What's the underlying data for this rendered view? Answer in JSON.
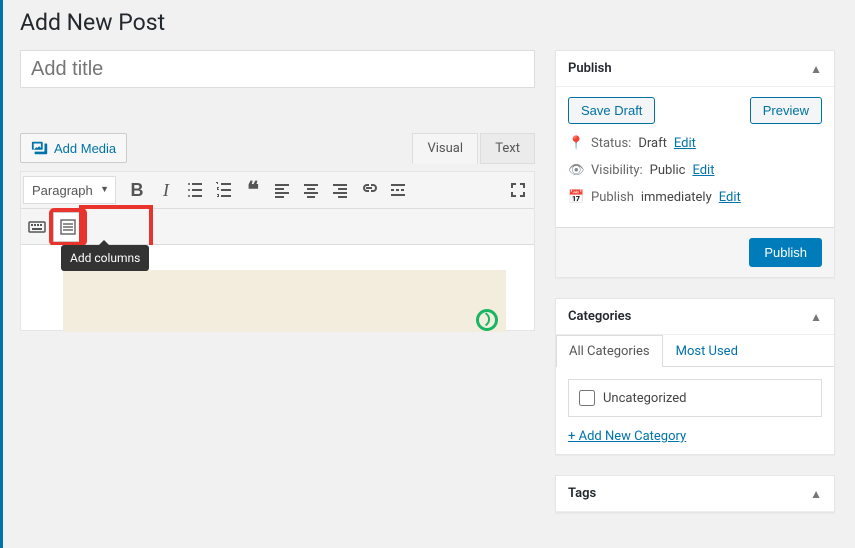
{
  "page_title": "Add New Post",
  "title_placeholder": "Add title",
  "add_media_label": "Add Media",
  "editor_tabs": {
    "visual": "Visual",
    "text": "Text"
  },
  "format_dropdown": "Paragraph",
  "tooltip_add_columns": "Add columns",
  "publish_panel": {
    "title": "Publish",
    "save_draft": "Save Draft",
    "preview": "Preview",
    "status_label": "Status:",
    "status_value": "Draft",
    "visibility_label": "Visibility:",
    "visibility_value": "Public",
    "schedule_label": "Publish",
    "schedule_value": "immediately",
    "edit": "Edit",
    "publish_btn": "Publish"
  },
  "categories_panel": {
    "title": "Categories",
    "tab_all": "All Categories",
    "tab_most": "Most Used",
    "items": [
      "Uncategorized"
    ],
    "add_new": "+ Add New Category"
  },
  "tags_panel": {
    "title": "Tags"
  }
}
